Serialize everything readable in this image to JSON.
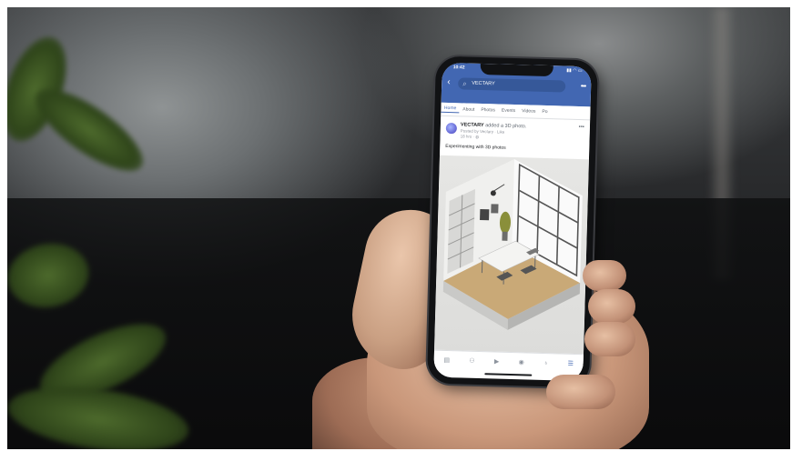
{
  "status_bar": {
    "time": "10:42",
    "icons": "▮▮ ◠ ▭"
  },
  "header": {
    "search_text": "VECTARY"
  },
  "tabs": [
    {
      "label": "Home"
    },
    {
      "label": "About"
    },
    {
      "label": "Photos"
    },
    {
      "label": "Events"
    },
    {
      "label": "Videos"
    },
    {
      "label": "Po"
    }
  ],
  "post": {
    "author": "VECTARY",
    "action": " added a 3D photo.",
    "subtitle": "Posted by Vectary · Like",
    "time": "18 hrs",
    "caption": "Experimenting with 3D photos"
  },
  "bottom_nav": [
    {
      "icon": "news-feed-icon"
    },
    {
      "icon": "friends-icon"
    },
    {
      "icon": "watch-icon"
    },
    {
      "icon": "groups-icon"
    },
    {
      "icon": "notifications-icon"
    },
    {
      "icon": "menu-icon"
    }
  ],
  "colors": {
    "facebook_blue": "#4267b2",
    "search_bar": "#365899"
  }
}
